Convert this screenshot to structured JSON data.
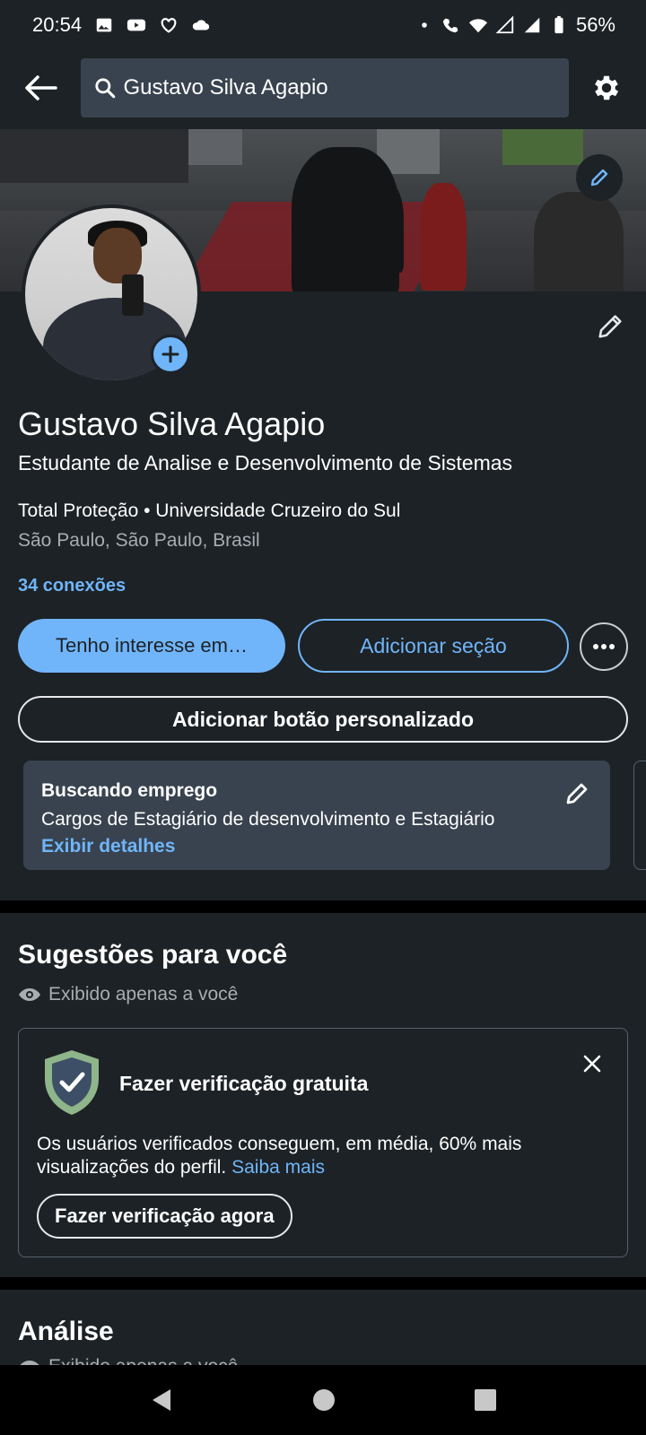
{
  "status_bar": {
    "time": "20:54",
    "battery": "56%"
  },
  "top_bar": {
    "search_value": "Gustavo Silva Agapio"
  },
  "profile": {
    "name": "Gustavo Silva Agapio",
    "headline": "Estudante de Analise e Desenvolvimento de Sistemas",
    "company_school": "Total Proteção • Universidade Cruzeiro do Sul",
    "location": "São Paulo, São Paulo, Brasil",
    "connections": "34 conexões"
  },
  "actions": {
    "interest_label": "Tenho interesse em…",
    "add_section_label": "Adicionar seção",
    "custom_button_label": "Adicionar botão personalizado"
  },
  "open_to_work": {
    "title": "Buscando emprego",
    "roles": "Cargos de Estagiário de desenvolvimento e Estagiário",
    "link": "Exibir detalhes"
  },
  "suggestions": {
    "title": "Sugestões para você",
    "visibility": "Exibido apenas a você",
    "card": {
      "title": "Fazer verificação gratuita",
      "text": "Os usuários verificados conseguem, em média, 60% mais visualizações do perfil.",
      "link": "Saiba mais",
      "button": "Fazer verificação agora"
    }
  },
  "analytics": {
    "title": "Análise",
    "visibility": "Exibido apenas a você"
  },
  "colors": {
    "background": "#1d2226",
    "accent": "#70b5f9",
    "card": "#38434f"
  }
}
